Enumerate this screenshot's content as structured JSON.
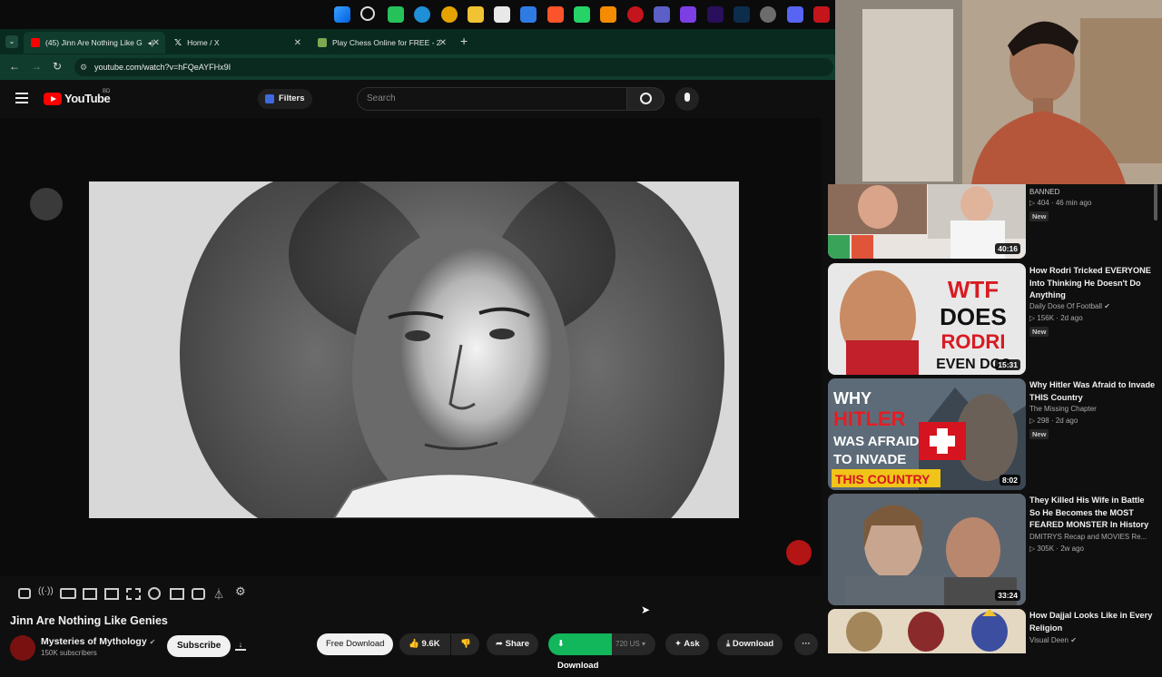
{
  "browser": {
    "tabs": [
      {
        "title": "(45) Jinn Are Nothing Like G",
        "active": true
      },
      {
        "title": "Home / X",
        "active": false
      },
      {
        "title": "Play Chess Online for FREE - 2",
        "active": false
      }
    ],
    "url": "youtube.com/watch?v=hFQeAYFHx9I"
  },
  "youtube": {
    "logo_text": "YouTube",
    "country_code": "BD",
    "filters_label": "Filters",
    "search_placeholder": "Search"
  },
  "video": {
    "title": "Jinn Are Nothing Like Genies",
    "channel": "Mysteries of Mythology",
    "subscribers": "150K subscribers",
    "subscribe_label": "Subscribe",
    "free_download_label": "Free Download",
    "likes": "9.6K",
    "share_label": "Share",
    "download_ext_label": "Download",
    "quality": "720",
    "quality_sep": "US",
    "ask_label": "Ask",
    "download_label": "Download"
  },
  "recommendations": [
    {
      "title": "BANNED",
      "channel": "",
      "views": "404",
      "age": "46 min ago",
      "badge": "New",
      "duration": "40:16"
    },
    {
      "title": "How Rodri Tricked EVERYONE Into Thinking He Doesn't Do Anything",
      "channel": "Daily Dose Of Football",
      "views": "156K",
      "age": "2d ago",
      "badge": "New",
      "duration": "15:31"
    },
    {
      "title": "Why Hitler Was Afraid to Invade THIS Country",
      "channel": "The Missing Chapter",
      "views": "298",
      "age": "2d ago",
      "badge": "New",
      "duration": "8:02"
    },
    {
      "title": "They Killed His Wife in Battle So He Becomes the MOST FEARED MONSTER In History",
      "channel": "DMITRYS Recap and MOVIES Re...",
      "views": "305K",
      "age": "2w ago",
      "badge": "",
      "duration": "33:24"
    },
    {
      "title": "How Dajjal Looks Like in Every Religion",
      "channel": "Visual Deen",
      "views": "",
      "age": "",
      "badge": "",
      "duration": ""
    }
  ],
  "thumb_text": {
    "rodri": [
      "WTF",
      "DOES",
      "RODRI",
      "EVEN DO?"
    ],
    "hitler": [
      "WHY",
      "HITLER",
      "WAS AFRAID",
      "TO INVADE",
      "THIS COUNTRY"
    ]
  },
  "colors": {
    "yt_red": "#ff0000",
    "download_green": "#12b65b",
    "browser_theme": "#103c2e"
  }
}
